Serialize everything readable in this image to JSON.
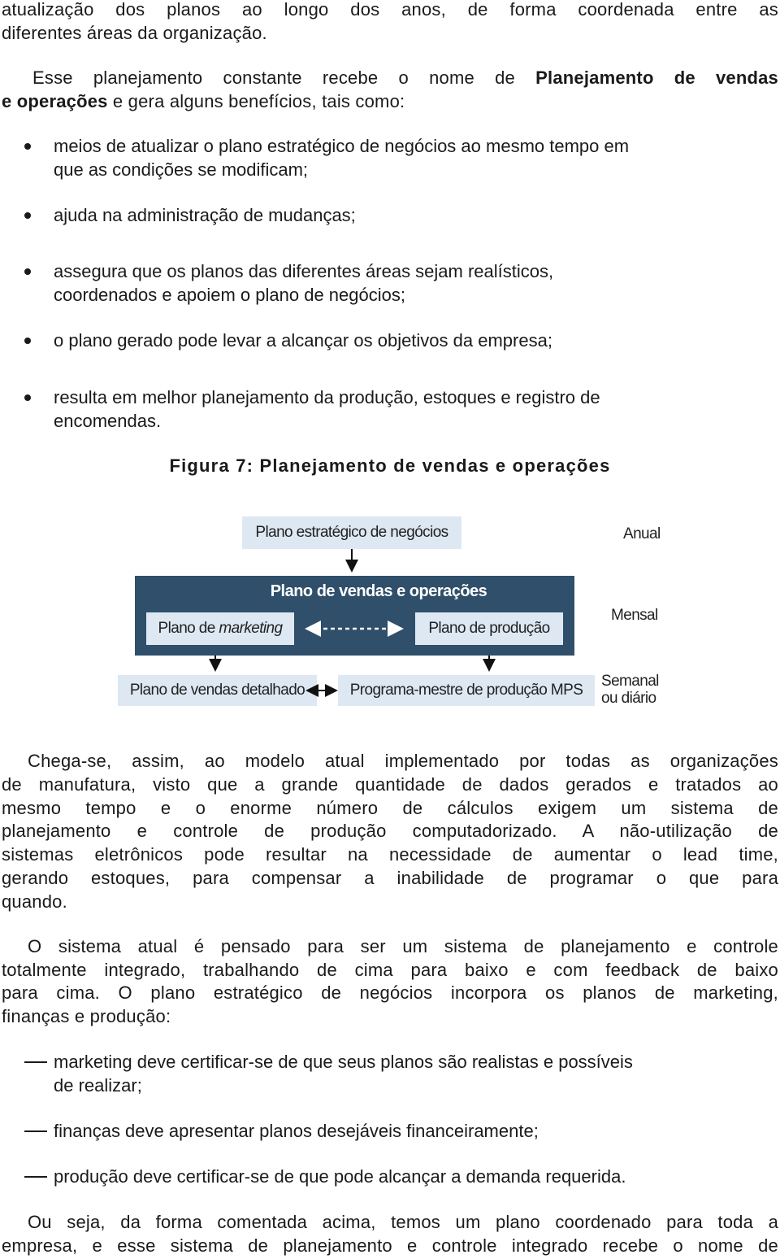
{
  "intro_lines": [
    "atualização dos planos ao longo dos anos, de forma coordenada entre as",
    "diferentes áreas da organização."
  ],
  "para1": {
    "line1_prefix": "Esse planejamento constante recebe o nome de ",
    "line1_bold": "Planejamento de vendas",
    "line2_bold": "e operações",
    "line2_suffix": " e gera alguns benefícios, tais como:"
  },
  "benefits": [
    [
      "meios de atualizar o plano estratégico de negócios ao mesmo tempo em",
      "que as condições se modificam;"
    ],
    [
      "ajuda na administração de mudanças;"
    ],
    [
      "assegura que os planos das diferentes áreas sejam realísticos,",
      "coordenados e apoiem o plano de negócios;"
    ],
    [
      "o plano gerado pode levar a alcançar os objetivos da empresa;"
    ],
    [
      "resulta em melhor planejamento da produção, estoques e registro de",
      "encomendas."
    ]
  ],
  "figure": {
    "caption": "Figura 7: Planejamento de vendas e operações",
    "boxes": {
      "strategic": "Plano estratégico de negócios",
      "sop_title": "Plano de vendas e operações",
      "marketing_prefix": "Plano de ",
      "marketing_italic": "marketing",
      "production": "Plano de produção",
      "sales_detail": "Plano de vendas detalhado",
      "mps": "Programa-mestre de produção MPS"
    },
    "frequencies": {
      "annual": "Anual",
      "monthly": "Mensal",
      "weekly_1": "Semanal",
      "weekly_2": "ou diário"
    },
    "colors": {
      "light_box": "#dde8f3",
      "dark_panel": "#2f4f6a"
    }
  },
  "para2": [
    "Chega-se, assim, ao modelo atual implementado por todas as organizações",
    "de manufatura, visto que a grande quantidade de dados gerados e tratados ao",
    "mesmo tempo e o enorme número de cálculos exigem um sistema de",
    "planejamento e controle de produção computadorizado. A não-utilização de",
    "sistemas eletrônicos pode resultar na necessidade de aumentar o lead time,",
    "gerando estoques, para compensar a inabilidade de programar o que para",
    "quando."
  ],
  "para3": [
    "O sistema atual é pensado para ser um sistema de planejamento e controle",
    "totalmente integrado, trabalhando de cima para baixo e com feedback de baixo",
    "para cima. O plano estratégico de negócios incorpora os planos de marketing,",
    "finanças e produção:"
  ],
  "dash_items": [
    [
      "marketing deve certificar-se de que seus planos são realistas e possíveis",
      "de realizar;"
    ],
    [
      "finanças deve apresentar planos desejáveis financeiramente;"
    ],
    [
      "produção deve certificar-se de que pode alcançar a demanda requerida."
    ]
  ],
  "para4": [
    "Ou seja, da forma comentada acima, temos um plano coordenado para toda a",
    "empresa, e esse sistema de planejamento e controle integrado recebe o nome de"
  ]
}
